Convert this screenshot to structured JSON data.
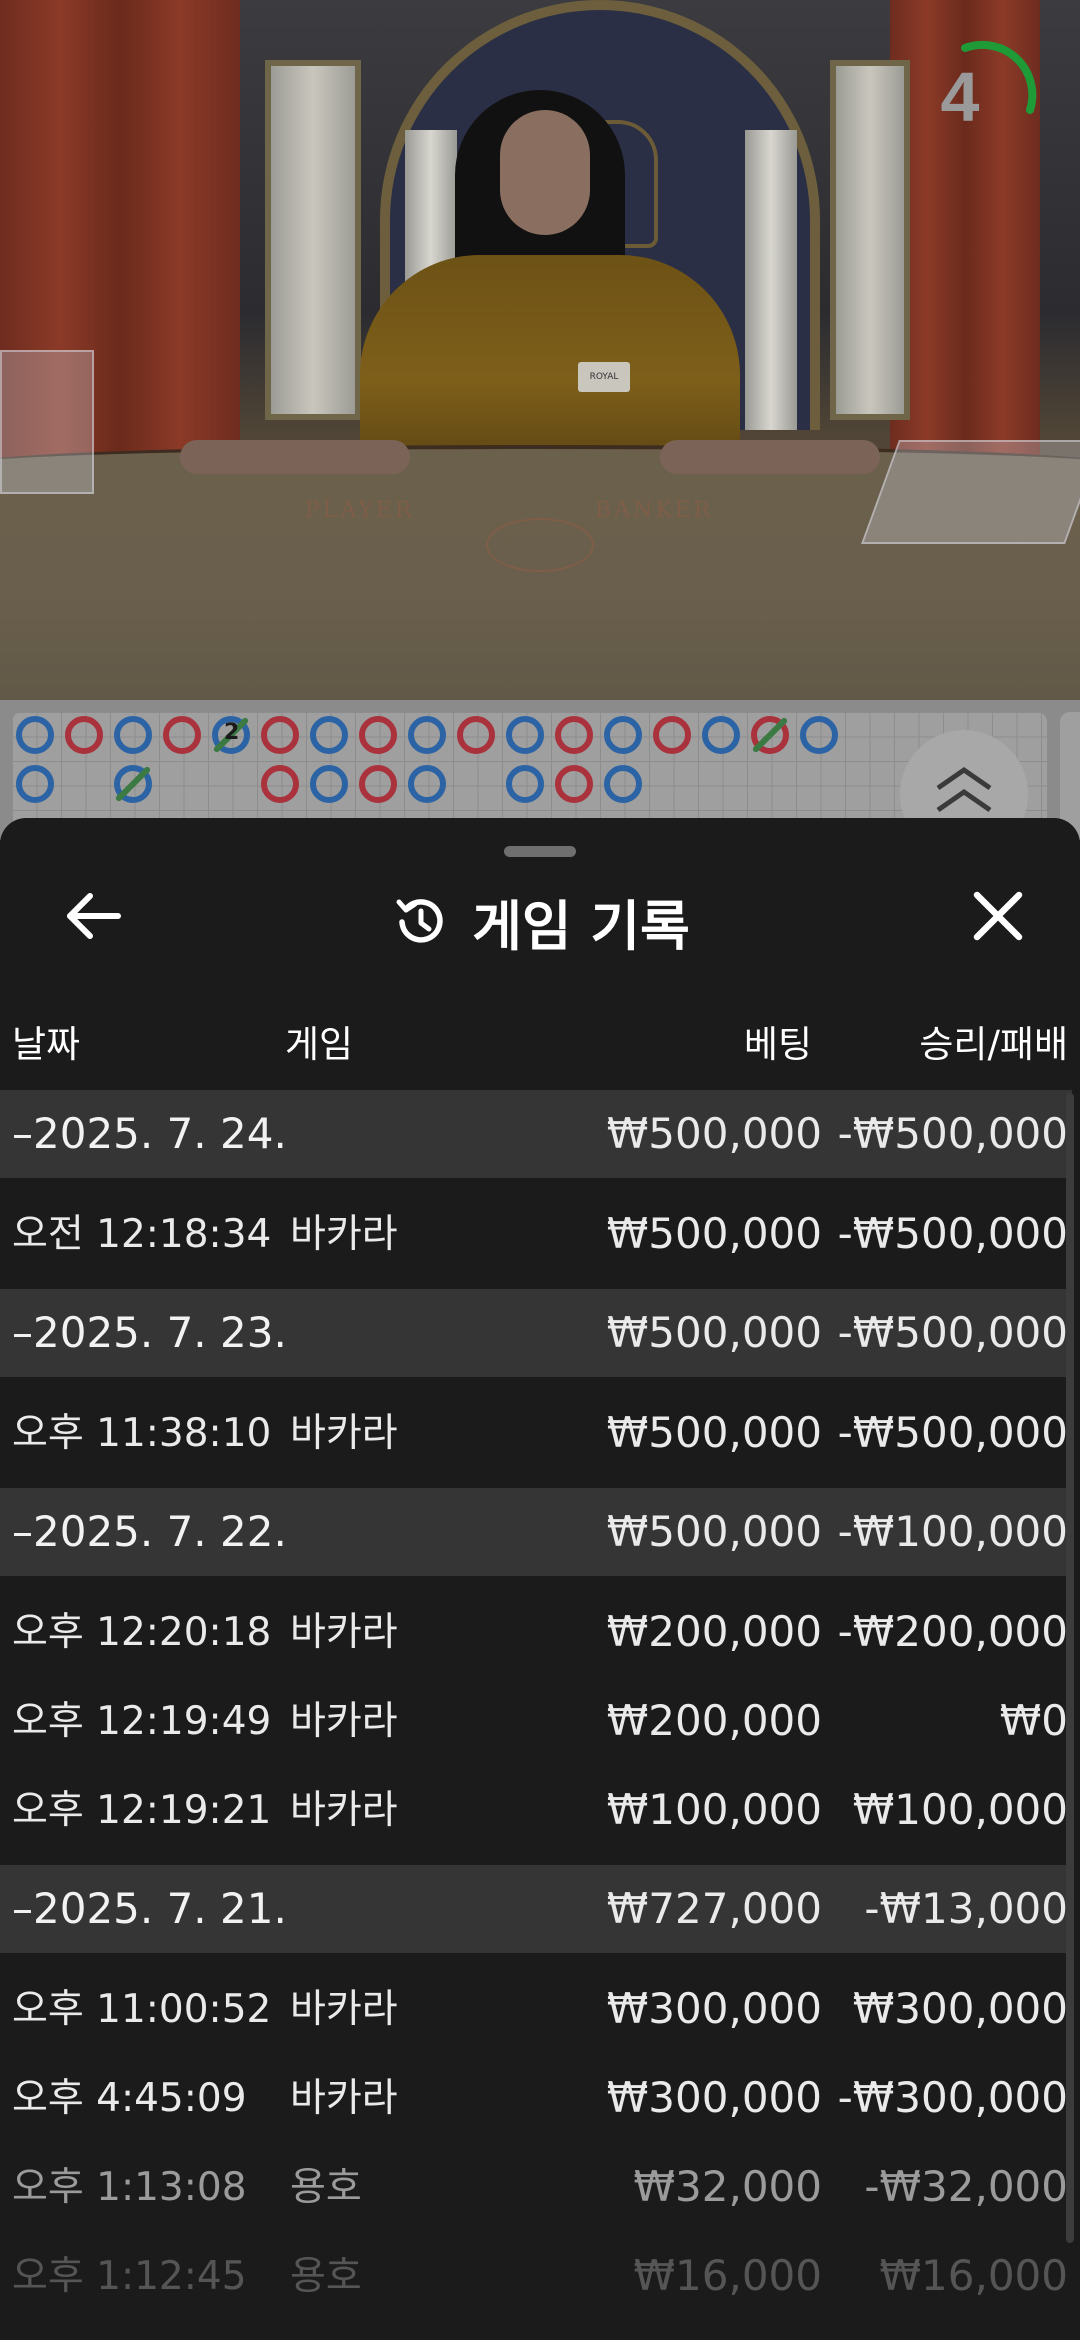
{
  "stream": {
    "timer_value": "4",
    "felt_player_label": "PLAYER",
    "felt_banker_label": "BANKER",
    "name_tag": "ROYAL"
  },
  "roadmap": {
    "beads": [
      {
        "row": 0,
        "col": 0,
        "side": "player"
      },
      {
        "row": 1,
        "col": 0,
        "side": "player"
      },
      {
        "row": 0,
        "col": 1,
        "side": "banker"
      },
      {
        "row": 0,
        "col": 2,
        "side": "player"
      },
      {
        "row": 1,
        "col": 2,
        "side": "player",
        "tie": true
      },
      {
        "row": 0,
        "col": 3,
        "side": "banker"
      },
      {
        "row": 0,
        "col": 4,
        "side": "player",
        "tie": true,
        "tie_count": "2"
      },
      {
        "row": 0,
        "col": 5,
        "side": "banker"
      },
      {
        "row": 1,
        "col": 5,
        "side": "banker"
      },
      {
        "row": 0,
        "col": 6,
        "side": "player"
      },
      {
        "row": 1,
        "col": 6,
        "side": "player"
      },
      {
        "row": 0,
        "col": 7,
        "side": "banker"
      },
      {
        "row": 1,
        "col": 7,
        "side": "banker"
      },
      {
        "row": 0,
        "col": 8,
        "side": "player"
      },
      {
        "row": 1,
        "col": 8,
        "side": "player"
      },
      {
        "row": 0,
        "col": 9,
        "side": "banker"
      },
      {
        "row": 0,
        "col": 10,
        "side": "player"
      },
      {
        "row": 1,
        "col": 10,
        "side": "player"
      },
      {
        "row": 0,
        "col": 11,
        "side": "banker"
      },
      {
        "row": 1,
        "col": 11,
        "side": "banker"
      },
      {
        "row": 0,
        "col": 12,
        "side": "player"
      },
      {
        "row": 1,
        "col": 12,
        "side": "player"
      },
      {
        "row": 0,
        "col": 13,
        "side": "banker"
      },
      {
        "row": 0,
        "col": 14,
        "side": "player"
      },
      {
        "row": 0,
        "col": 15,
        "side": "banker",
        "tie": true
      },
      {
        "row": 0,
        "col": 16,
        "side": "player"
      }
    ],
    "colors": {
      "player": "#2b63a5",
      "banker": "#a9323c",
      "tie": "#3b7a43"
    }
  },
  "sheet": {
    "title": "게임 기록",
    "back_icon": "arrow-left-icon",
    "history_icon": "history-icon",
    "close_icon": "close-icon"
  },
  "columns": {
    "date": "날짜",
    "game": "게임",
    "bet": "베팅",
    "result": "승리/패배"
  },
  "history": [
    {
      "date": "–2025. 7. 24.",
      "bet": "₩500,000",
      "result": "-₩500,000",
      "entries": [
        {
          "time": "오전 12:18:34",
          "game": "바카라",
          "bet": "₩500,000",
          "result": "-₩500,000"
        }
      ]
    },
    {
      "date": "–2025. 7. 23.",
      "bet": "₩500,000",
      "result": "-₩500,000",
      "entries": [
        {
          "time": "오후 11:38:10",
          "game": "바카라",
          "bet": "₩500,000",
          "result": "-₩500,000"
        }
      ]
    },
    {
      "date": "–2025. 7. 22.",
      "bet": "₩500,000",
      "result": "-₩100,000",
      "entries": [
        {
          "time": "오후 12:20:18",
          "game": "바카라",
          "bet": "₩200,000",
          "result": "-₩200,000"
        },
        {
          "time": "오후 12:19:49",
          "game": "바카라",
          "bet": "₩200,000",
          "result": "₩0"
        },
        {
          "time": "오후 12:19:21",
          "game": "바카라",
          "bet": "₩100,000",
          "result": "₩100,000"
        }
      ]
    },
    {
      "date": "–2025. 7. 21.",
      "bet": "₩727,000",
      "result": "-₩13,000",
      "entries": [
        {
          "time": "오후 11:00:52",
          "game": "바카라",
          "bet": "₩300,000",
          "result": "₩300,000"
        },
        {
          "time": "오후 4:45:09",
          "game": "바카라",
          "bet": "₩300,000",
          "result": "-₩300,000"
        },
        {
          "time": "오후 1:13:08",
          "game": "용호",
          "bet": "₩32,000",
          "result": "-₩32,000"
        },
        {
          "time": "오후 1:12:45",
          "game": "용호",
          "bet": "₩16,000",
          "result": "₩16,000"
        }
      ]
    }
  ]
}
